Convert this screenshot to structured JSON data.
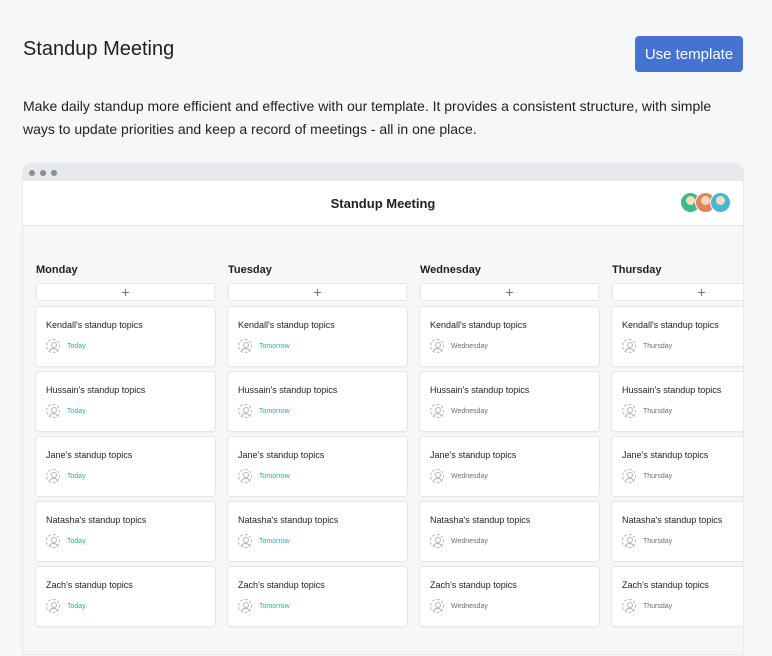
{
  "page": {
    "title": "Standup Meeting",
    "use_template_label": "Use template",
    "description": "Make daily standup more efficient and effective with our template. It provides a consistent structure, with simple ways to update priorities and keep a record of meetings - all in one place."
  },
  "preview": {
    "app_title": "Standup Meeting",
    "add_symbol": "+",
    "columns": [
      {
        "name": "Monday",
        "cards": [
          {
            "title": "Kendall's standup topics",
            "due": "Today"
          },
          {
            "title": "Hussain's standup topics",
            "due": "Today"
          },
          {
            "title": "Jane's standup topics",
            "due": "Today"
          },
          {
            "title": "Natasha's standup topics",
            "due": "Today"
          },
          {
            "title": "Zach's standup topics",
            "due": "Today"
          }
        ]
      },
      {
        "name": "Tuesday",
        "cards": [
          {
            "title": "Kendall's standup topics",
            "due": "Tomorrow"
          },
          {
            "title": "Hussain's standup topics",
            "due": "Tomorrow"
          },
          {
            "title": "Jane's standup topics",
            "due": "Tomorrow"
          },
          {
            "title": "Natasha's standup topics",
            "due": "Tomorrow"
          },
          {
            "title": "Zach's standup topics",
            "due": "Tomorrow"
          }
        ]
      },
      {
        "name": "Wednesday",
        "cards": [
          {
            "title": "Kendall's standup topics",
            "due": "Wednesday"
          },
          {
            "title": "Hussain's standup topics",
            "due": "Wednesday"
          },
          {
            "title": "Jane's standup topics",
            "due": "Wednesday"
          },
          {
            "title": "Natasha's standup topics",
            "due": "Wednesday"
          },
          {
            "title": "Zach's standup topics",
            "due": "Wednesday"
          }
        ]
      },
      {
        "name": "Thursday",
        "cards": [
          {
            "title": "Kendall's standup topics",
            "due": "Thursday"
          },
          {
            "title": "Hussain's standup topics",
            "due": "Thursday"
          },
          {
            "title": "Jane's standup topics",
            "due": "Thursday"
          },
          {
            "title": "Natasha's standup topics",
            "due": "Thursday"
          },
          {
            "title": "Zach's standup topics",
            "due": "Thursday"
          }
        ]
      }
    ]
  },
  "colors": {
    "accent": "#4573d2",
    "due_soon": "#26b09b",
    "due_later": "#6d6e6f"
  },
  "icons": {
    "chrome_dots": "window-dots-icon",
    "assignee": "person-icon",
    "add": "plus-icon"
  }
}
